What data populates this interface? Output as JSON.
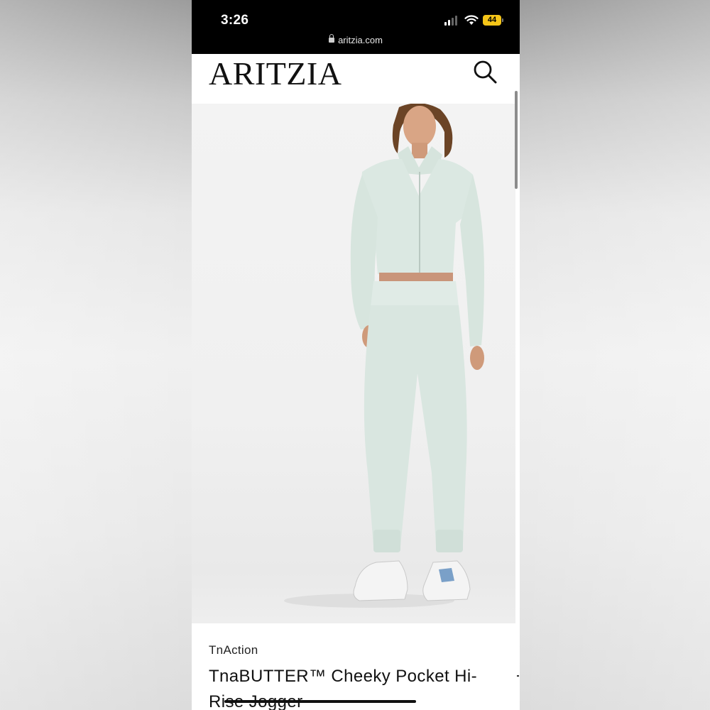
{
  "status_bar": {
    "time": "3:26",
    "battery": "44",
    "url": "aritzia.com"
  },
  "header": {
    "logo": "ARITZIA"
  },
  "product": {
    "brand": "TnAction",
    "title": "TnaBUTTER™ Cheeky Pocket Hi-Rise Jogger"
  },
  "icons": {
    "search": "search-icon",
    "lock": "lock-icon",
    "wifi": "wifi-icon",
    "signal": "signal-icon",
    "battery": "battery-icon"
  },
  "colors": {
    "garment": "#dbe8e2",
    "battery": "#f5c518",
    "status_bar_bg": "#000000"
  }
}
